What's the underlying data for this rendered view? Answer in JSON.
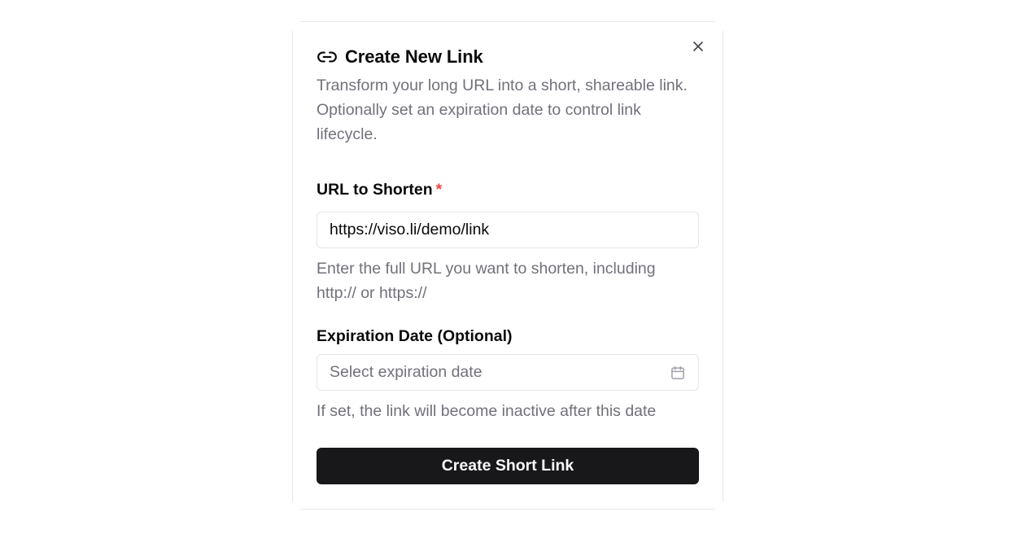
{
  "dialog": {
    "title": "Create New Link",
    "title_icon": "link-icon",
    "close_icon": "close-icon",
    "description": "Transform your long URL into a short, shareable link. Optionally set an expiration date to control link lifecycle."
  },
  "url_field": {
    "label": "URL to Shorten",
    "required_marker": "*",
    "value": "https://viso.li/demo/link",
    "help": "Enter the full URL you want to shorten, including http:// or https://"
  },
  "expiration_field": {
    "label": "Expiration Date (Optional)",
    "placeholder": "Select expiration date",
    "icon": "calendar-icon",
    "help": "If set, the link will become inactive after this date"
  },
  "submit": {
    "label": "Create Short Link"
  },
  "colors": {
    "primary": "#18181b",
    "muted_text": "#71717a",
    "required": "#ef4444",
    "border": "#e4e4e7"
  }
}
